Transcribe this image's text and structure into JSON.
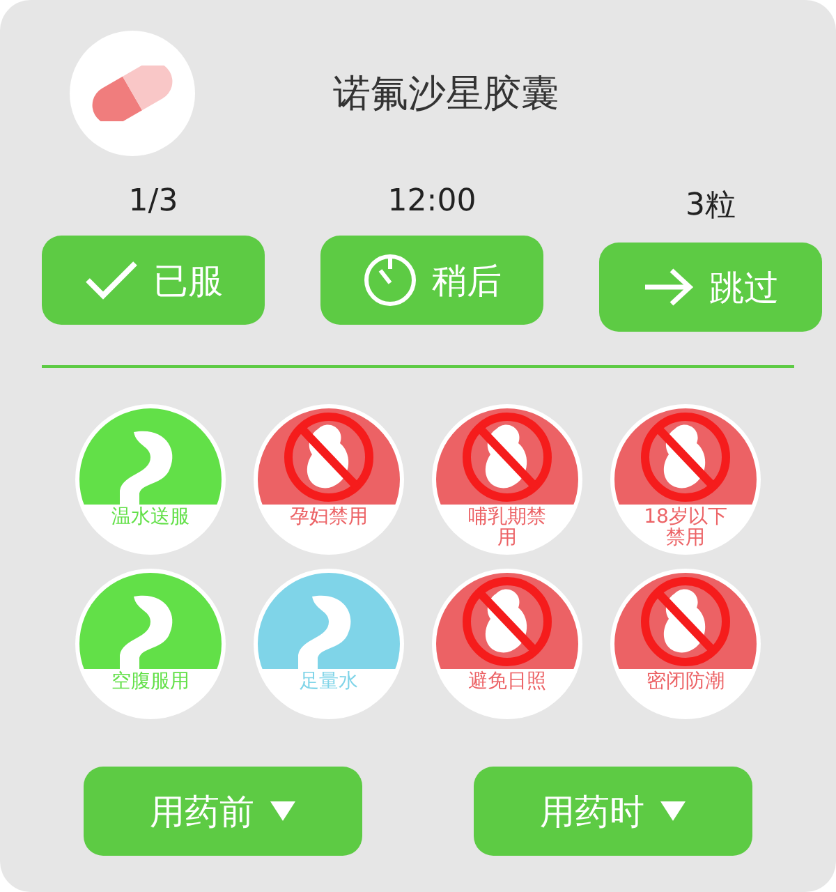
{
  "title": "诺氟沙星胶囊",
  "doses": [
    {
      "reading": "1/3",
      "action": "已服",
      "kind": "check"
    },
    {
      "reading": "12:00",
      "action": "稍后",
      "kind": "timer"
    },
    {
      "reading": "3粒",
      "action": "跳过",
      "kind": "arrow"
    }
  ],
  "tips": [
    {
      "label": "温水送服",
      "kind": "advice",
      "color": "#62e048"
    },
    {
      "label": "孕妇禁用",
      "kind": "forbidden",
      "color": "#ec6265"
    },
    {
      "label": "哺乳期禁用",
      "kind": "forbidden",
      "color": "#ec6265"
    },
    {
      "label": "18岁以下禁用",
      "kind": "forbidden",
      "color": "#ec6265"
    },
    {
      "label": "空腹服用",
      "kind": "advice",
      "color": "#62e048"
    },
    {
      "label": "足量水",
      "kind": "advice",
      "color": "#7fd4e8"
    },
    {
      "label": "避免日照",
      "kind": "forbidden",
      "color": "#ec6265"
    },
    {
      "label": "密闭防潮",
      "kind": "forbidden",
      "color": "#ec6265"
    }
  ],
  "footer": [
    "用药前",
    "用药时"
  ]
}
